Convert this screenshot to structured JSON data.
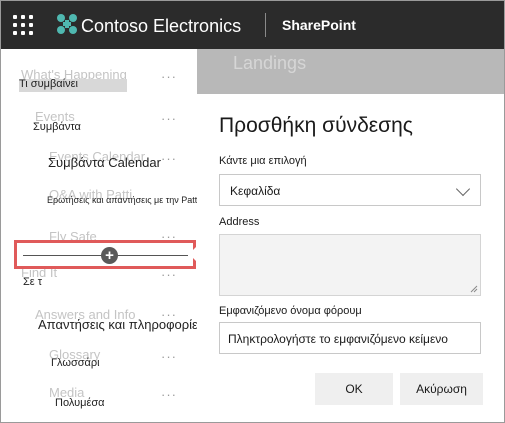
{
  "suite_bar": {
    "brand": "Contoso Electronics",
    "app_name": "SharePoint"
  },
  "nav": {
    "ghost_top": "What's Happening",
    "ti_label": "Τι συμβαίνει",
    "ghost_events": "Events",
    "events_label": "Συμβάντα",
    "ghost_calendar": "Events Calendar",
    "calendar_label": "Συμβάντα Calendar",
    "ghost_qa": "Q&A with Patti",
    "qa_label": "Ερωτήσεις και απαντήσεις με την Patti",
    "ghost_flysafe": "Fly Safe",
    "ghost_findit": "Find It",
    "findit_label": "Σε τ",
    "ghost_answers": "Answers and Info",
    "answers_label": "Απαντήσεις και πληροφορίες",
    "ghost_glossary": "Glossary",
    "glossary_label": "Γλωσσάρι",
    "ghost_media": "Media",
    "media_label": "Πολυμέσα",
    "more": "···"
  },
  "page": {
    "ghost_title": "Landings"
  },
  "panel": {
    "title": "Προσθήκη σύνδεσης",
    "choose_label": "Κάντε μια επιλογή",
    "choose_value": "Κεφαλίδα",
    "address_label": "Address",
    "name_label": "Εμφανιζόμενο όνομα φόρουμ",
    "name_placeholder": "Πληκτρολογήστε το εμφανιζόμενο κείμενο",
    "ok_label": "OK",
    "cancel_label": "Ακύρωση",
    "cancel_ghost": "Cancel"
  },
  "colors": {
    "suite_bar": "#2b2b2b",
    "highlight": "#e05a5a",
    "brand_logo": "#4fb8b0"
  },
  "icons": [
    "waffle-icon",
    "contoso-logo-icon",
    "chevron-down-icon",
    "add-link-plus-icon",
    "more-ellipsis-icon"
  ]
}
